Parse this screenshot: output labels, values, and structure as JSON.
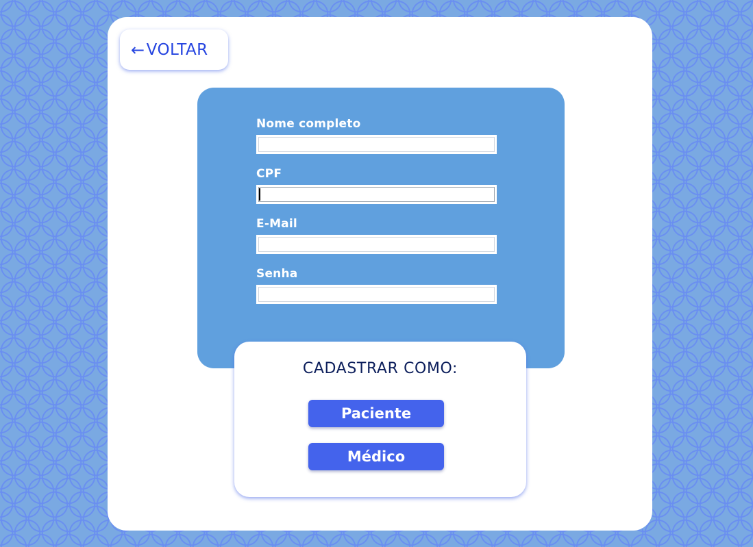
{
  "back_button": {
    "arrow": "←",
    "label": "VOLTAR"
  },
  "form": {
    "fields": [
      {
        "label": "Nome completo",
        "value": ""
      },
      {
        "label": "CPF",
        "value": ""
      },
      {
        "label": "E-Mail",
        "value": ""
      },
      {
        "label": "Senha",
        "value": ""
      }
    ]
  },
  "register_as": {
    "title": "CADASTRAR COMO:",
    "patient_label": "Paciente",
    "doctor_label": "Médico"
  },
  "colors": {
    "background": "#7aa9e2",
    "form_panel": "#60a0de",
    "accent_button": "#4463ec",
    "back_text": "#2645e0",
    "title_text": "#0d1f5c"
  }
}
